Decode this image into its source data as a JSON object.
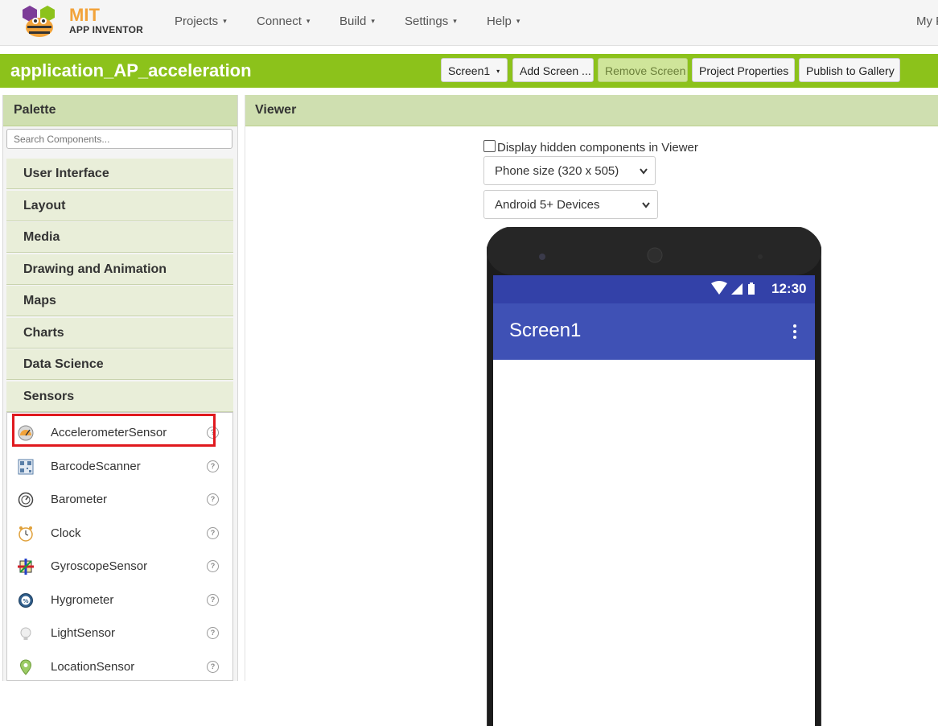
{
  "brand": {
    "line1": "MIT",
    "line2": "APP INVENTOR",
    "color_orange": "#f2a33a",
    "color_purple": "#7d3c98"
  },
  "nav": {
    "items": [
      "Projects",
      "Connect",
      "Build",
      "Settings",
      "Help"
    ],
    "caret": "▾",
    "right_label": "My P"
  },
  "project": {
    "name": "application_AP_acceleration",
    "bar_color": "#8cc21b",
    "screen_select": "Screen1",
    "add_screen": "Add Screen ...",
    "remove_screen": "Remove Screen",
    "properties": "Project Properties",
    "publish": "Publish to Gallery"
  },
  "palette": {
    "title": "Palette",
    "search_placeholder": "Search Components...",
    "categories": [
      "User Interface",
      "Layout",
      "Media",
      "Drawing and Animation",
      "Maps",
      "Charts",
      "Data Science",
      "Sensors"
    ],
    "sensors": [
      {
        "label": "AccelerometerSensor",
        "icon": "accelerometer-icon"
      },
      {
        "label": "BarcodeScanner",
        "icon": "barcode-icon"
      },
      {
        "label": "Barometer",
        "icon": "barometer-icon"
      },
      {
        "label": "Clock",
        "icon": "clock-icon"
      },
      {
        "label": "GyroscopeSensor",
        "icon": "gyroscope-icon"
      },
      {
        "label": "Hygrometer",
        "icon": "hygrometer-icon"
      },
      {
        "label": "LightSensor",
        "icon": "light-sensor-icon"
      },
      {
        "label": "LocationSensor",
        "icon": "location-sensor-icon"
      }
    ],
    "help_glyph": "?",
    "highlight_color": "#e0191e"
  },
  "viewer": {
    "title": "Viewer",
    "hidden_components_label": "Display hidden components in Viewer",
    "size_select": "Phone size (320 x 505)",
    "device_select": "Android 5+ Devices",
    "phone": {
      "time": "12:30",
      "screen_title": "Screen1",
      "status_color": "#3341a8",
      "appbar_color": "#3f51b5"
    }
  }
}
